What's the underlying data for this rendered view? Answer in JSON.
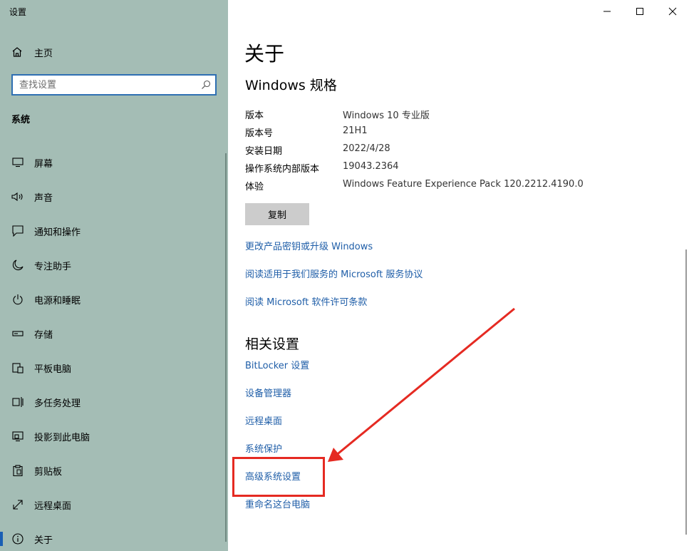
{
  "sidebar": {
    "app_title": "设置",
    "home_label": "主页",
    "search_placeholder": "查找设置",
    "section_title": "系统",
    "items": [
      {
        "label": "屏幕",
        "icon": "monitor-icon"
      },
      {
        "label": "声音",
        "icon": "speaker-icon"
      },
      {
        "label": "通知和操作",
        "icon": "notification-icon"
      },
      {
        "label": "专注助手",
        "icon": "moon-icon"
      },
      {
        "label": "电源和睡眠",
        "icon": "power-icon"
      },
      {
        "label": "存储",
        "icon": "storage-icon"
      },
      {
        "label": "平板电脑",
        "icon": "tablet-icon"
      },
      {
        "label": "多任务处理",
        "icon": "multitasking-icon"
      },
      {
        "label": "投影到此电脑",
        "icon": "project-icon"
      },
      {
        "label": "剪贴板",
        "icon": "clipboard-icon"
      },
      {
        "label": "远程桌面",
        "icon": "remote-desktop-icon"
      },
      {
        "label": "关于",
        "icon": "info-icon",
        "active": true
      }
    ]
  },
  "main": {
    "title": "关于",
    "spec_title": "Windows 规格",
    "specs": [
      {
        "label": "版本",
        "value": "Windows 10 专业版"
      },
      {
        "label": "版本号",
        "value": "21H1"
      },
      {
        "label": "安装日期",
        "value": "2022/4/28"
      },
      {
        "label": "操作系统内部版本",
        "value": "19043.2364"
      },
      {
        "label": "体验",
        "value": "Windows Feature Experience Pack 120.2212.4190.0"
      }
    ],
    "copy_label": "复制",
    "links": [
      "更改产品密钥或升级 Windows",
      "阅读适用于我们服务的 Microsoft 服务协议",
      "阅读 Microsoft 软件许可条款"
    ],
    "related_title": "相关设置",
    "related_links": [
      "BitLocker 设置",
      "设备管理器",
      "远程桌面",
      "系统保护",
      "高级系统设置",
      "重命名这台电脑"
    ]
  },
  "annotation": {
    "color": "#e52a22"
  }
}
